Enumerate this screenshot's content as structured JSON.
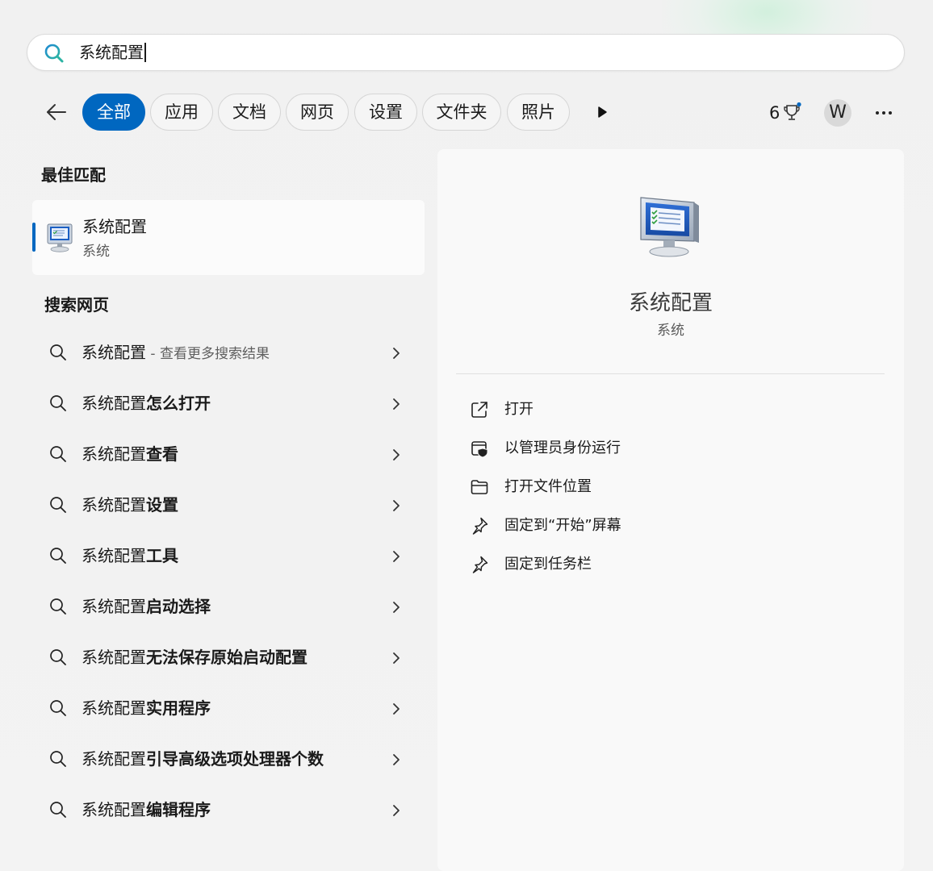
{
  "search": {
    "query": "系统配置"
  },
  "filters": {
    "tabs": [
      {
        "label": "全部",
        "active": true
      },
      {
        "label": "应用"
      },
      {
        "label": "文档"
      },
      {
        "label": "网页"
      },
      {
        "label": "设置"
      },
      {
        "label": "文件夹"
      },
      {
        "label": "照片"
      }
    ],
    "points": "6",
    "avatar_letter": "W"
  },
  "best_match": {
    "heading": "最佳匹配",
    "title": "系统配置",
    "subtitle": "系统"
  },
  "web": {
    "heading": "搜索网页",
    "items": [
      {
        "prefix": "系统配置",
        "bold": "",
        "hint": " - 查看更多搜索结果"
      },
      {
        "prefix": "系统配置",
        "bold": "怎么打开",
        "hint": ""
      },
      {
        "prefix": "系统配置",
        "bold": "查看",
        "hint": ""
      },
      {
        "prefix": "系统配置",
        "bold": "设置",
        "hint": ""
      },
      {
        "prefix": "系统配置",
        "bold": "工具",
        "hint": ""
      },
      {
        "prefix": "系统配置",
        "bold": "启动选择",
        "hint": ""
      },
      {
        "prefix": "系统配置",
        "bold": "无法保存原始启动配置",
        "hint": ""
      },
      {
        "prefix": "系统配置",
        "bold": "实用程序",
        "hint": ""
      },
      {
        "prefix": "系统配置",
        "bold": "引导高级选项处理器个数",
        "hint": ""
      },
      {
        "prefix": "系统配置",
        "bold": "编辑程序",
        "hint": ""
      }
    ]
  },
  "detail": {
    "title": "系统配置",
    "subtitle": "系统",
    "actions": [
      {
        "label": "打开",
        "icon": "open-external-icon"
      },
      {
        "label": "以管理员身份运行",
        "icon": "run-as-admin-icon"
      },
      {
        "label": "打开文件位置",
        "icon": "folder-icon"
      },
      {
        "label": "固定到“开始”屏幕",
        "icon": "pin-icon"
      },
      {
        "label": "固定到任务栏",
        "icon": "pin-icon"
      }
    ]
  },
  "colors": {
    "accent": "#0067c0"
  }
}
